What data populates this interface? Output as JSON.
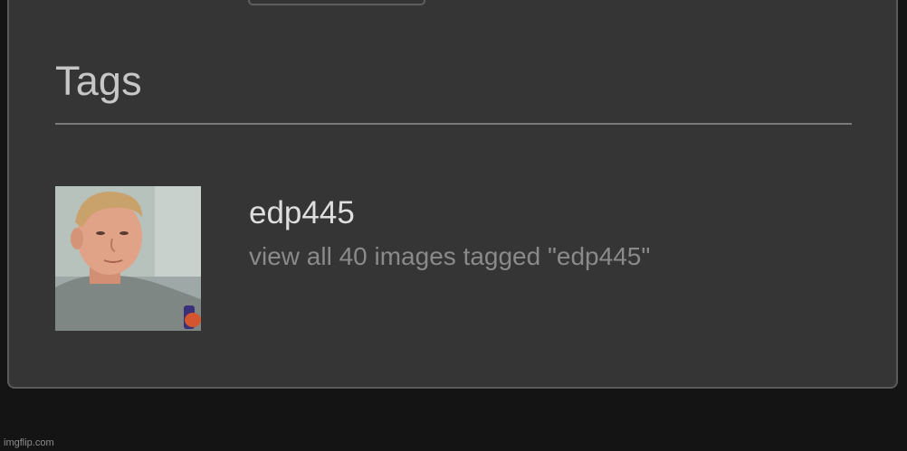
{
  "section": {
    "title": "Tags"
  },
  "tag": {
    "name": "edp445",
    "link_text": "view all 40 images tagged \"edp445\"",
    "image_count": 40
  },
  "watermark": "imgflip.com"
}
